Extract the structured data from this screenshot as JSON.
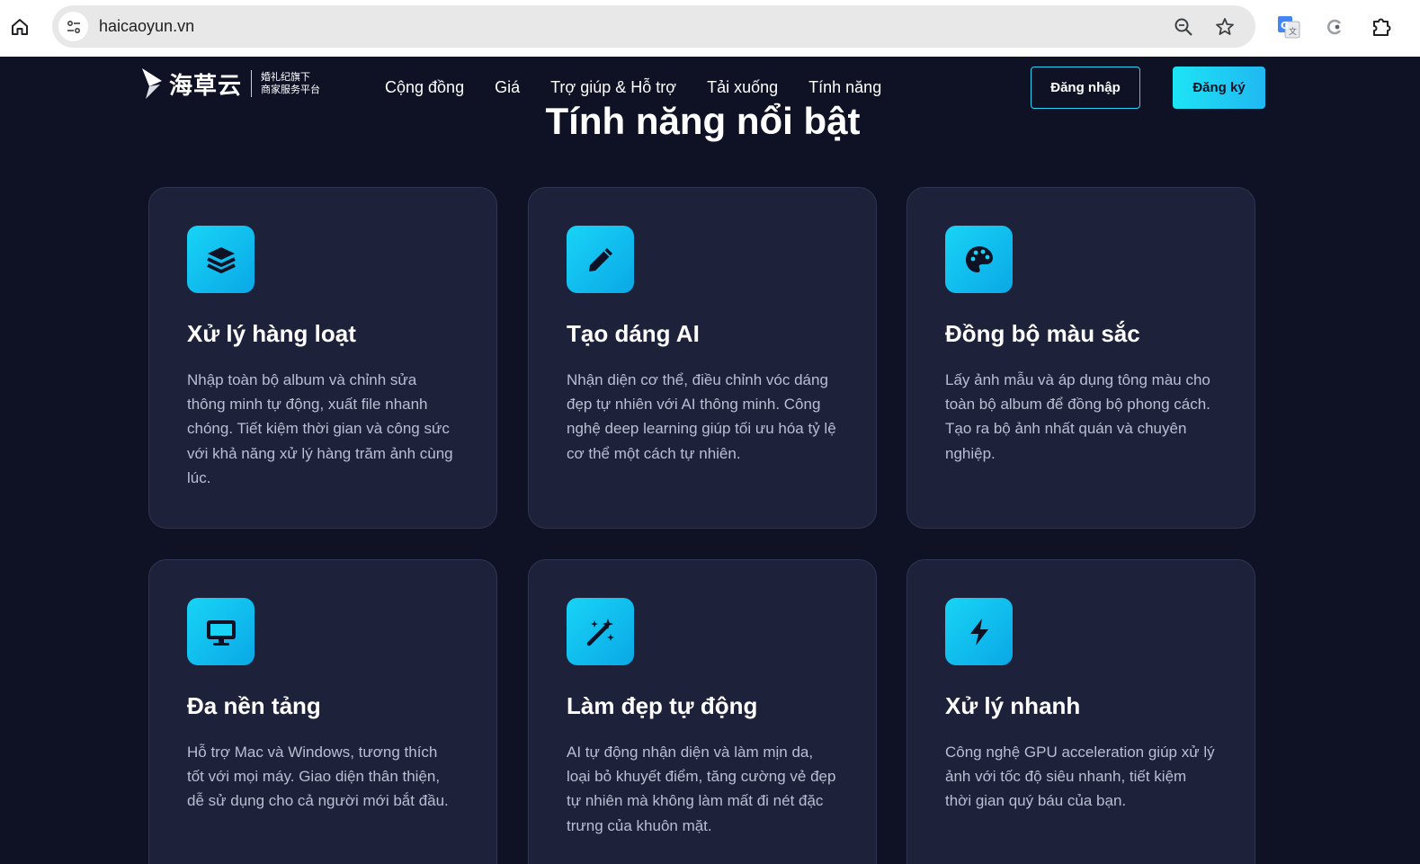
{
  "browser": {
    "url": "haicaoyun.vn"
  },
  "header": {
    "logo_cn": "海草云",
    "logo_sub_line1": "婚礼纪旗下",
    "logo_sub_line2": "商家服务平台",
    "nav": [
      "Cộng đồng",
      "Giá",
      "Trợ giúp & Hỗ trợ",
      "Tải xuống",
      "Tính năng"
    ],
    "login_label": "Đăng nhập",
    "signup_label": "Đăng ký"
  },
  "section": {
    "title": "Tính năng nổi bật"
  },
  "features": [
    {
      "icon": "layers-icon",
      "title": "Xử lý hàng loạt",
      "desc": "Nhập toàn bộ album và chỉnh sửa thông minh tự động, xuất file nhanh chóng. Tiết kiệm thời gian và công sức với khả năng xử lý hàng trăm ảnh cùng lúc."
    },
    {
      "icon": "pen-icon",
      "title": "Tạo dáng AI",
      "desc": "Nhận diện cơ thể, điều chỉnh vóc dáng đẹp tự nhiên với AI thông minh. Công nghệ deep learning giúp tối ưu hóa tỷ lệ cơ thể một cách tự nhiên."
    },
    {
      "icon": "palette-icon",
      "title": "Đồng bộ màu sắc",
      "desc": "Lấy ảnh mẫu và áp dụng tông màu cho toàn bộ album để đồng bộ phong cách. Tạo ra bộ ảnh nhất quán và chuyên nghiệp."
    },
    {
      "icon": "monitor-icon",
      "title": "Đa nền tảng",
      "desc": "Hỗ trợ Mac và Windows, tương thích tốt với mọi máy. Giao diện thân thiện, dễ sử dụng cho cả người mới bắt đầu."
    },
    {
      "icon": "magic-wand-icon",
      "title": "Làm đẹp tự động",
      "desc": "AI tự động nhận diện và làm mịn da, loại bỏ khuyết điểm, tăng cường vẻ đẹp tự nhiên mà không làm mất đi nét đặc trưng của khuôn mặt."
    },
    {
      "icon": "bolt-icon",
      "title": "Xử lý nhanh",
      "desc": "Công nghệ GPU acceleration giúp xử lý ảnh với tốc độ siêu nhanh, tiết kiệm thời gian quý báu của bạn."
    }
  ],
  "colors": {
    "page_bg": "#0f1224",
    "card_bg": "#1d2139",
    "accent": "#18d4f6"
  }
}
